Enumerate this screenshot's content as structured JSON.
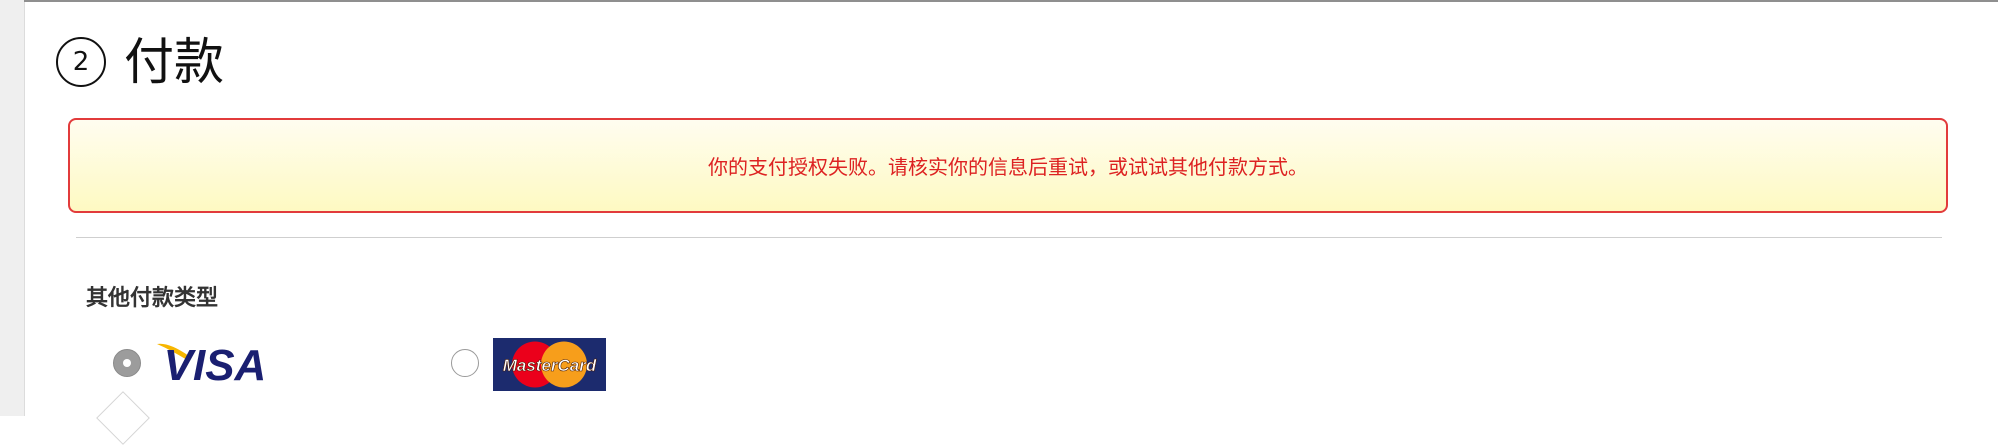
{
  "payment": {
    "step_number": "2",
    "title": "付款"
  },
  "error": {
    "message": "你的支付授权失败。请核实你的信息后重试，或试试其他付款方式。"
  },
  "other_payment": {
    "label": "其他付款类型",
    "options": [
      {
        "name": "VISA",
        "icon": "visa-logo-icon",
        "selected": true
      },
      {
        "name": "MasterCard",
        "icon": "mastercard-logo-icon",
        "selected": false
      }
    ]
  },
  "colors": {
    "error_text": "#dd2222",
    "error_border": "#e23b3b",
    "error_background": "#fef9c2",
    "visa_blue": "#1a1f71",
    "visa_gold": "#f7b600",
    "mc_red": "#eb001b",
    "mc_orange": "#f79e1b"
  }
}
